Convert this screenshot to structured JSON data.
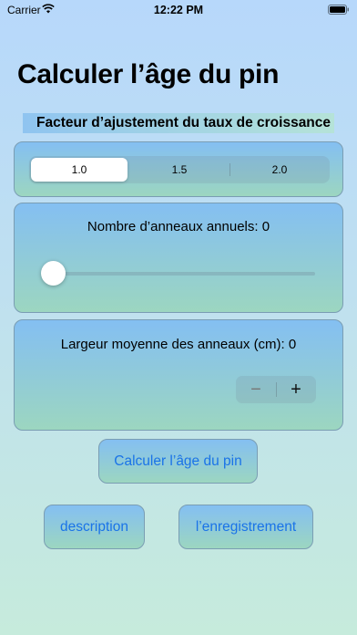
{
  "status_bar": {
    "carrier": "Carrier",
    "time": "12:22 PM"
  },
  "title": "Calculer l’âge du pin",
  "growth_factor": {
    "label": "Facteur d’ajustement du taux de croissance",
    "options": [
      "1.0",
      "1.5",
      "2.0"
    ],
    "selected": "1.0"
  },
  "rings": {
    "label": "Nombre d’anneaux annuels: 0",
    "slider_value": 0
  },
  "width": {
    "label": "Largeur moyenne des anneaux (cm): 0",
    "minus": "−",
    "plus": "+"
  },
  "buttons": {
    "calculate": "Calculer l’âge du pin",
    "description": "description",
    "record": "l’enregistrement"
  },
  "colors": {
    "accent": "#1a73e8",
    "card_top": "#84bff2",
    "card_bottom": "#9cd6c0"
  }
}
